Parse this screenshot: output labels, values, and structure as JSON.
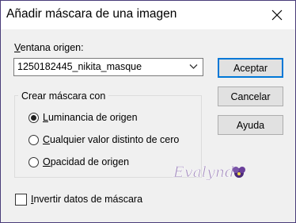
{
  "dialog": {
    "title": "Añadir máscara de una imagen"
  },
  "source": {
    "label_mnemonic": "V",
    "label_rest": "entana origen:",
    "selected": "1250182445_nikita_masque"
  },
  "buttons": {
    "ok": "Aceptar",
    "cancel": "Cancelar",
    "help": "Ayuda"
  },
  "mask_group": {
    "title": "Crear máscara con",
    "options": [
      {
        "mnemonic": "L",
        "rest": "uminancia de origen",
        "checked": true
      },
      {
        "mnemonic": "C",
        "rest": "ualquier valor distinto de cero",
        "checked": false
      },
      {
        "mnemonic": "O",
        "rest": "pacidad de origen",
        "checked": false
      }
    ]
  },
  "invert": {
    "mnemonic": "I",
    "rest": "nvertir datos de máscara",
    "checked": false
  },
  "watermark": {
    "text": "Evalynda"
  },
  "colors": {
    "accent": "#0078d7",
    "frame": "#4a3d7a"
  },
  "icons": {
    "close": "close-icon",
    "dropdown": "chevron-down-icon"
  }
}
